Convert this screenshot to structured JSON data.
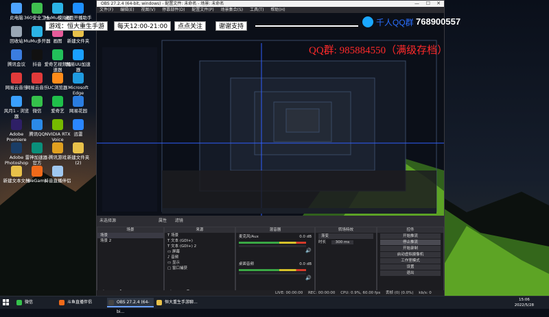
{
  "desktop": {
    "icons": [
      {
        "label": "此电脑",
        "color": "#4da3ff"
      },
      {
        "label": "360安全卫士",
        "color": "#3fbf4f"
      },
      {
        "label": "MuMu模拟器",
        "color": "#2bb3e6"
      },
      {
        "label": "桌面开播助手",
        "color": "#1e90ff"
      },
      {
        "label": "回收站",
        "color": "#9aa7b5"
      },
      {
        "label": "MuMu多开器",
        "color": "#2bb3e6"
      },
      {
        "label": "画图",
        "color": "#e65b9a"
      },
      {
        "label": "新建文件夹",
        "color": "#e8c14a"
      },
      {
        "label": "腾讯会议",
        "color": "#3b7de0"
      },
      {
        "label": "抖音",
        "color": "#111111"
      },
      {
        "label": "爱奇艺视频加速器",
        "color": "#22c05a"
      },
      {
        "label": "网易UU加速器",
        "color": "#1aa0ff"
      },
      {
        "label": "网易云音乐",
        "color": "#e03a3a"
      },
      {
        "label": "网易云音乐",
        "color": "#e03a3a"
      },
      {
        "label": "UC浏览器",
        "color": "#ff8c1a"
      },
      {
        "label": "Microsoft Edge",
        "color": "#1f9be0"
      },
      {
        "label": "风月1 - 浏览器",
        "color": "#3aa0ff"
      },
      {
        "label": "微信",
        "color": "#35c14b"
      },
      {
        "label": "爱奇艺",
        "color": "#1fbf4a"
      },
      {
        "label": "网易花园",
        "color": "#2a7de0"
      },
      {
        "label": "Adobe Premiere",
        "color": "#2e1f66"
      },
      {
        "label": "腾讯QQ",
        "color": "#2b8ae8"
      },
      {
        "label": "NVIDIA RTX Voice",
        "color": "#76b900"
      },
      {
        "label": "迅雷",
        "color": "#2a86ff"
      },
      {
        "label": "Adobe Photoshop",
        "color": "#1a3d66"
      },
      {
        "label": "雷神加速器-官方",
        "color": "#0a8f7a"
      },
      {
        "label": "腾讯游戏",
        "color": "#e0a020"
      },
      {
        "label": "新建文件夹 (2)",
        "color": "#e8c14a"
      },
      {
        "label": "新建文本文档",
        "color": "#e8c14a"
      },
      {
        "label": "WeGame",
        "color": "#f06a1a"
      },
      {
        "label": "抖音直播伴侣",
        "color": "#a0c8f0"
      }
    ]
  },
  "obs": {
    "title": "OBS 27.2.4 (64-bit, windows) - 配置文件: 未命名 - 场景: 未命名",
    "menu": [
      "文件(F)",
      "编辑(E)",
      "视图(V)",
      "停靠部件(D)",
      "配置文件(P)",
      "场景集合(S)",
      "工具(T)",
      "帮助(H)"
    ],
    "overlay": {
      "game": "游戏：恒大重生手游",
      "time": "每天12:00-21:00",
      "follow": "点点关注",
      "thanks": "谢谢支持",
      "qq_group_label": "千人QQ群",
      "qq_group_number": "768900557",
      "red_text": "QQ群: 985884550（满级存档）"
    },
    "scene_bar_label": "未选择源",
    "scene_bar_buttons": [
      "属性",
      "滤镜"
    ],
    "panels": {
      "scenes": {
        "title": "场景",
        "items": [
          "场景",
          "场景 2"
        ]
      },
      "sources": {
        "title": "来源",
        "items": [
          "场景",
          "文本 (GDI+)",
          "文本 (GDI+) 2",
          "屏幕",
          "音频",
          "显示",
          "窗口捕获"
        ]
      },
      "mixer": {
        "title": "混音器",
        "channels": [
          {
            "name": "麦克风/Aux",
            "db": "0.0 dB"
          },
          {
            "name": "桌面音频",
            "db": "0.0 dB"
          }
        ]
      },
      "transitions": {
        "title": "转场特效",
        "type": "渐变",
        "duration_label": "时长",
        "duration": "300 ms"
      },
      "controls": {
        "title": "控件",
        "buttons": [
          "开始推流",
          "停止推流",
          "开始录制",
          "启动虚拟摄像机",
          "工作室模式",
          "设置",
          "退出"
        ],
        "highlight": "停止推流"
      }
    },
    "status": {
      "live": "LIVE: 00:00:00",
      "rec": "REC: 00:00:00",
      "cpu": "CPU: 0.9%, 60.00 fps",
      "dropped": "丢帧 (0) (0.0%)",
      "kbps": "kb/s: 0"
    }
  },
  "taskbar": {
    "items": [
      {
        "label": "微信",
        "color": "#35c14b"
      },
      {
        "label": "斗鱼直播伴侣",
        "color": "#f06a1a"
      },
      {
        "label": "OBS 27.2.4 (64-bi...",
        "color": "#444444"
      },
      {
        "label": "恒大重生手游聊...",
        "color": "#e8c14a"
      }
    ],
    "time": "15:06",
    "date": "2022/5/28"
  },
  "colors": {
    "accent": "#6aa0ff",
    "overlay_red": "#ff2a2a",
    "obs_bg": "#1f1f23"
  }
}
